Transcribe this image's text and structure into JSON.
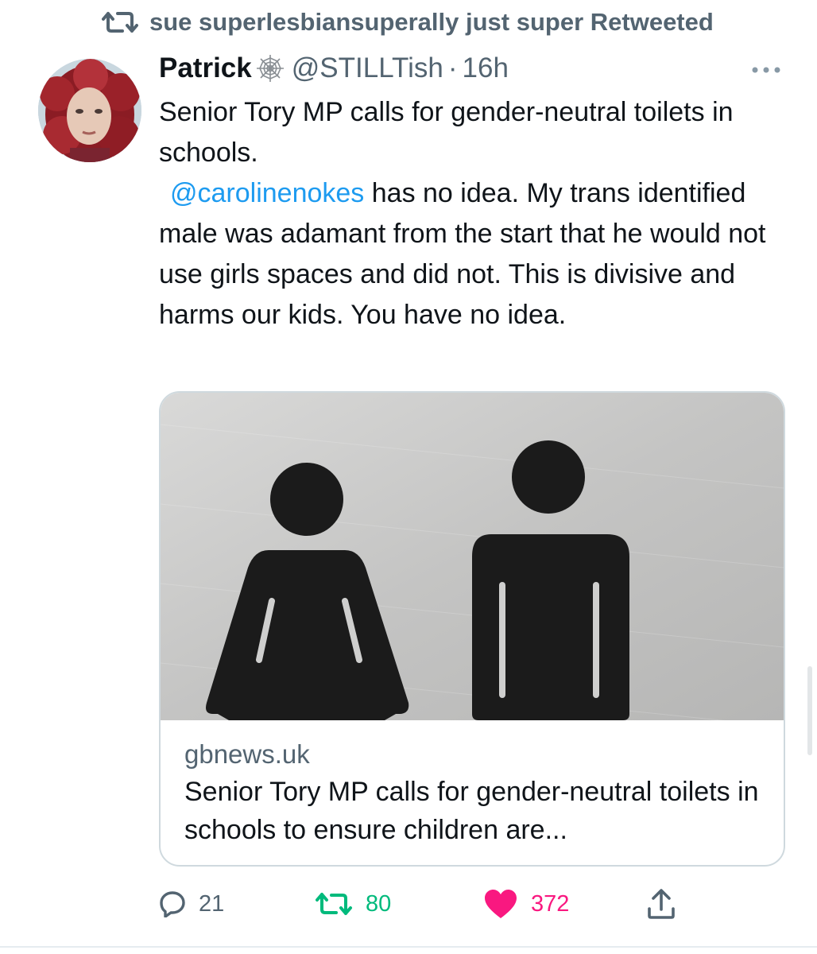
{
  "retweet_banner": {
    "text": "sue superlesbiansuperally just super Retweeted",
    "icon": "retweet-icon"
  },
  "tweet": {
    "author_name": "Patrick",
    "author_badge_icon": "spiderweb-icon",
    "handle": "@STILLTish",
    "separator": "·",
    "time": "16h",
    "more_icon": "more-options-icon",
    "text_line1": "Senior Tory MP calls for gender-neutral toilets in schools.",
    "mention": "@carolinenokes",
    "text_line2": " has no idea. My trans identified male was adamant from the start that he would not use girls spaces and did not. This is divisive and harms our kids. You have no idea.",
    "mention_color": "#1d9bf0"
  },
  "card": {
    "image_icon": "toilet-sign-image",
    "domain": "gbnews.uk",
    "title": "Senior Tory MP calls for gender-neutral toilets in schools to ensure children are..."
  },
  "actions": {
    "replies": "21",
    "retweets": "80",
    "likes": "372",
    "reply_icon": "reply-icon",
    "retweet_icon": "retweet-icon",
    "like_icon": "heart-icon",
    "share_icon": "share-icon",
    "retweet_color": "#00ba7c",
    "like_color": "#f91880",
    "muted_color": "#536471"
  }
}
